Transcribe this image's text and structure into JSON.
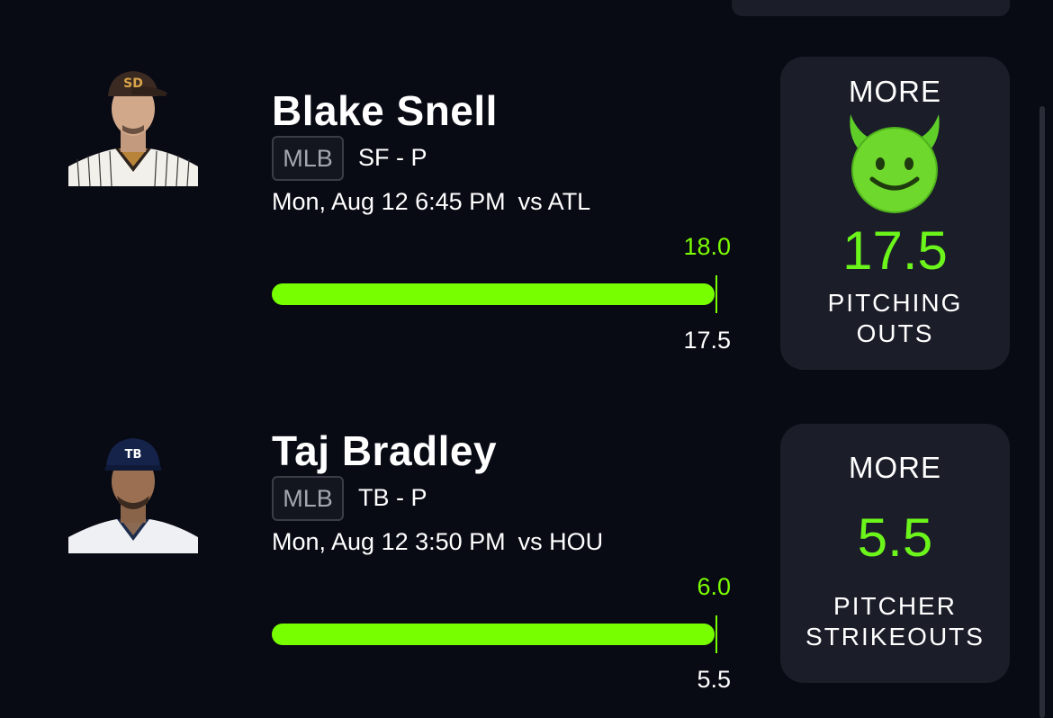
{
  "colors": {
    "background": "#080a14",
    "card": "#1b1d29",
    "accent_green": "#77ff00"
  },
  "players": [
    {
      "name": "Blake Snell",
      "league": "MLB",
      "team_pos": "SF - P",
      "game_time": "Mon, Aug 12 6:45 PM",
      "opponent": "vs ATL",
      "projection": "18.0",
      "line": "17.5",
      "bar_fill_fraction": 1.0,
      "pick": "MORE",
      "pick_icon": "smiling-devil-emoji",
      "stat_value": "17.5",
      "stat_line1": "PITCHING",
      "stat_line2": "OUTS"
    },
    {
      "name": "Taj Bradley",
      "league": "MLB",
      "team_pos": "TB - P",
      "game_time": "Mon, Aug 12 3:50 PM",
      "opponent": "vs HOU",
      "projection": "6.0",
      "line": "5.5",
      "bar_fill_fraction": 1.0,
      "pick": "MORE",
      "stat_value": "5.5",
      "stat_line1": "PITCHER",
      "stat_line2": "STRIKEOUTS"
    }
  ]
}
